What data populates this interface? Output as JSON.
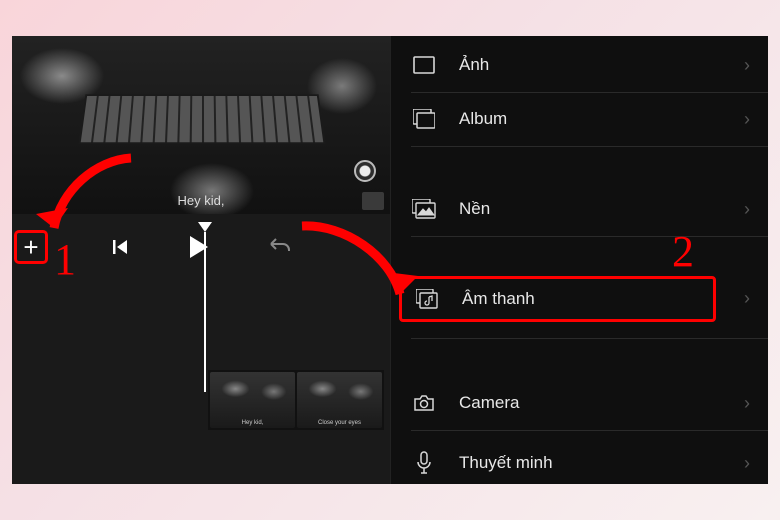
{
  "preview": {
    "caption": "Hey kid,"
  },
  "thumbnails": {
    "cap_left": "Hey kid,",
    "cap_right": "Close your eyes"
  },
  "menu": {
    "photo": {
      "label": "Ảnh"
    },
    "album": {
      "label": "Album"
    },
    "bg": {
      "label": "Nền"
    },
    "audio": {
      "label": "Âm thanh"
    },
    "camera": {
      "label": "Camera"
    },
    "narrate": {
      "label": "Thuyết minh"
    }
  },
  "annotation": {
    "step1": "1",
    "step2": "2"
  }
}
